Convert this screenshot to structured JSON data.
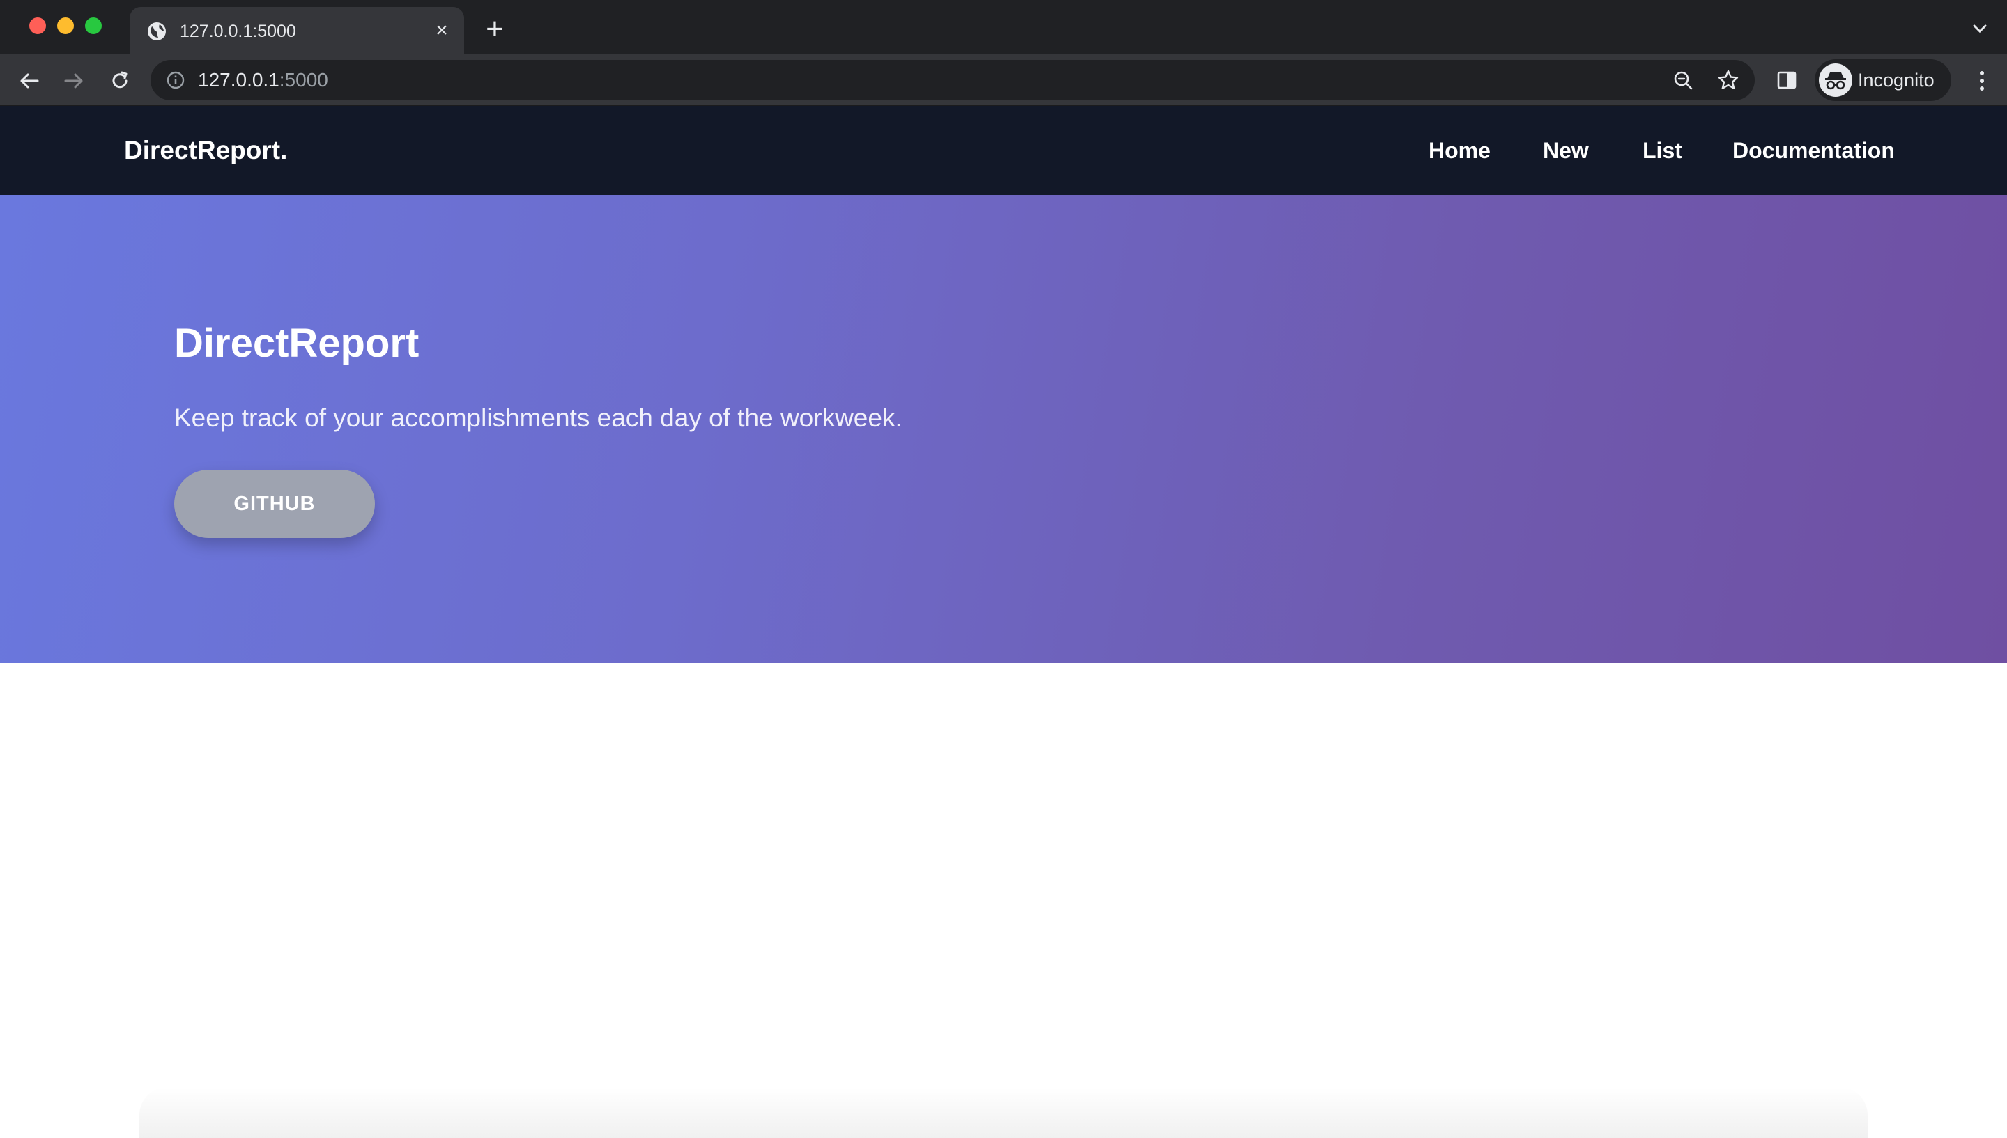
{
  "browser": {
    "tab": {
      "title": "127.0.0.1:5000",
      "icon": "globe-icon"
    },
    "address": {
      "host": "127.0.0.1",
      "port": ":5000"
    },
    "profile": {
      "label": "Incognito"
    },
    "colors": {
      "chrome_dark": "#202124",
      "chrome_toolbar": "#35363a"
    }
  },
  "site": {
    "nav": {
      "brand": "DirectReport.",
      "links": [
        "Home",
        "New",
        "List",
        "Documentation"
      ]
    },
    "hero": {
      "title": "DirectReport",
      "subtitle": "Keep track of your accomplishments each day of the workweek.",
      "button": "GITHUB"
    },
    "colors": {
      "nav_bg": "#121828",
      "hero_gradient_start": "#6a78de",
      "hero_gradient_end": "#6f4fa2",
      "button_bg": "#9ea3b0"
    }
  }
}
